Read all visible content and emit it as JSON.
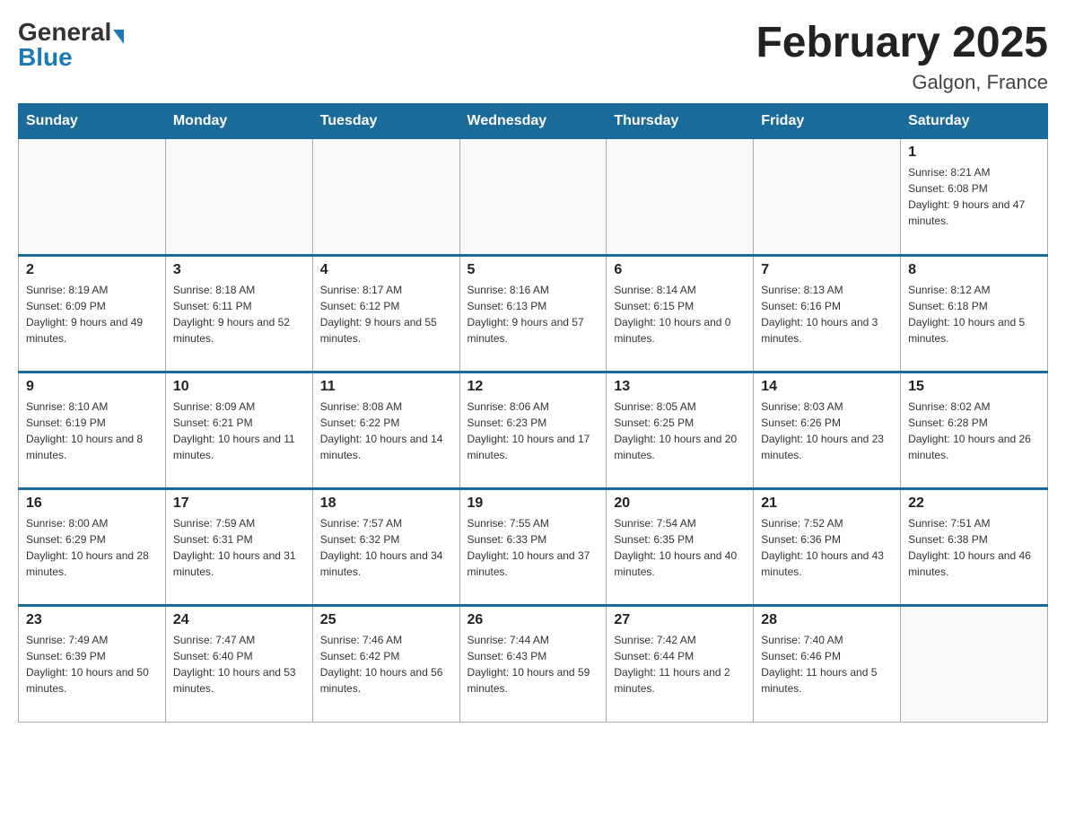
{
  "header": {
    "logo_general": "General",
    "logo_blue": "Blue",
    "title": "February 2025",
    "subtitle": "Galgon, France"
  },
  "days_of_week": [
    "Sunday",
    "Monday",
    "Tuesday",
    "Wednesday",
    "Thursday",
    "Friday",
    "Saturday"
  ],
  "weeks": [
    [
      {
        "day": "",
        "info": ""
      },
      {
        "day": "",
        "info": ""
      },
      {
        "day": "",
        "info": ""
      },
      {
        "day": "",
        "info": ""
      },
      {
        "day": "",
        "info": ""
      },
      {
        "day": "",
        "info": ""
      },
      {
        "day": "1",
        "info": "Sunrise: 8:21 AM\nSunset: 6:08 PM\nDaylight: 9 hours and 47 minutes."
      }
    ],
    [
      {
        "day": "2",
        "info": "Sunrise: 8:19 AM\nSunset: 6:09 PM\nDaylight: 9 hours and 49 minutes."
      },
      {
        "day": "3",
        "info": "Sunrise: 8:18 AM\nSunset: 6:11 PM\nDaylight: 9 hours and 52 minutes."
      },
      {
        "day": "4",
        "info": "Sunrise: 8:17 AM\nSunset: 6:12 PM\nDaylight: 9 hours and 55 minutes."
      },
      {
        "day": "5",
        "info": "Sunrise: 8:16 AM\nSunset: 6:13 PM\nDaylight: 9 hours and 57 minutes."
      },
      {
        "day": "6",
        "info": "Sunrise: 8:14 AM\nSunset: 6:15 PM\nDaylight: 10 hours and 0 minutes."
      },
      {
        "day": "7",
        "info": "Sunrise: 8:13 AM\nSunset: 6:16 PM\nDaylight: 10 hours and 3 minutes."
      },
      {
        "day": "8",
        "info": "Sunrise: 8:12 AM\nSunset: 6:18 PM\nDaylight: 10 hours and 5 minutes."
      }
    ],
    [
      {
        "day": "9",
        "info": "Sunrise: 8:10 AM\nSunset: 6:19 PM\nDaylight: 10 hours and 8 minutes."
      },
      {
        "day": "10",
        "info": "Sunrise: 8:09 AM\nSunset: 6:21 PM\nDaylight: 10 hours and 11 minutes."
      },
      {
        "day": "11",
        "info": "Sunrise: 8:08 AM\nSunset: 6:22 PM\nDaylight: 10 hours and 14 minutes."
      },
      {
        "day": "12",
        "info": "Sunrise: 8:06 AM\nSunset: 6:23 PM\nDaylight: 10 hours and 17 minutes."
      },
      {
        "day": "13",
        "info": "Sunrise: 8:05 AM\nSunset: 6:25 PM\nDaylight: 10 hours and 20 minutes."
      },
      {
        "day": "14",
        "info": "Sunrise: 8:03 AM\nSunset: 6:26 PM\nDaylight: 10 hours and 23 minutes."
      },
      {
        "day": "15",
        "info": "Sunrise: 8:02 AM\nSunset: 6:28 PM\nDaylight: 10 hours and 26 minutes."
      }
    ],
    [
      {
        "day": "16",
        "info": "Sunrise: 8:00 AM\nSunset: 6:29 PM\nDaylight: 10 hours and 28 minutes."
      },
      {
        "day": "17",
        "info": "Sunrise: 7:59 AM\nSunset: 6:31 PM\nDaylight: 10 hours and 31 minutes."
      },
      {
        "day": "18",
        "info": "Sunrise: 7:57 AM\nSunset: 6:32 PM\nDaylight: 10 hours and 34 minutes."
      },
      {
        "day": "19",
        "info": "Sunrise: 7:55 AM\nSunset: 6:33 PM\nDaylight: 10 hours and 37 minutes."
      },
      {
        "day": "20",
        "info": "Sunrise: 7:54 AM\nSunset: 6:35 PM\nDaylight: 10 hours and 40 minutes."
      },
      {
        "day": "21",
        "info": "Sunrise: 7:52 AM\nSunset: 6:36 PM\nDaylight: 10 hours and 43 minutes."
      },
      {
        "day": "22",
        "info": "Sunrise: 7:51 AM\nSunset: 6:38 PM\nDaylight: 10 hours and 46 minutes."
      }
    ],
    [
      {
        "day": "23",
        "info": "Sunrise: 7:49 AM\nSunset: 6:39 PM\nDaylight: 10 hours and 50 minutes."
      },
      {
        "day": "24",
        "info": "Sunrise: 7:47 AM\nSunset: 6:40 PM\nDaylight: 10 hours and 53 minutes."
      },
      {
        "day": "25",
        "info": "Sunrise: 7:46 AM\nSunset: 6:42 PM\nDaylight: 10 hours and 56 minutes."
      },
      {
        "day": "26",
        "info": "Sunrise: 7:44 AM\nSunset: 6:43 PM\nDaylight: 10 hours and 59 minutes."
      },
      {
        "day": "27",
        "info": "Sunrise: 7:42 AM\nSunset: 6:44 PM\nDaylight: 11 hours and 2 minutes."
      },
      {
        "day": "28",
        "info": "Sunrise: 7:40 AM\nSunset: 6:46 PM\nDaylight: 11 hours and 5 minutes."
      },
      {
        "day": "",
        "info": ""
      }
    ]
  ]
}
